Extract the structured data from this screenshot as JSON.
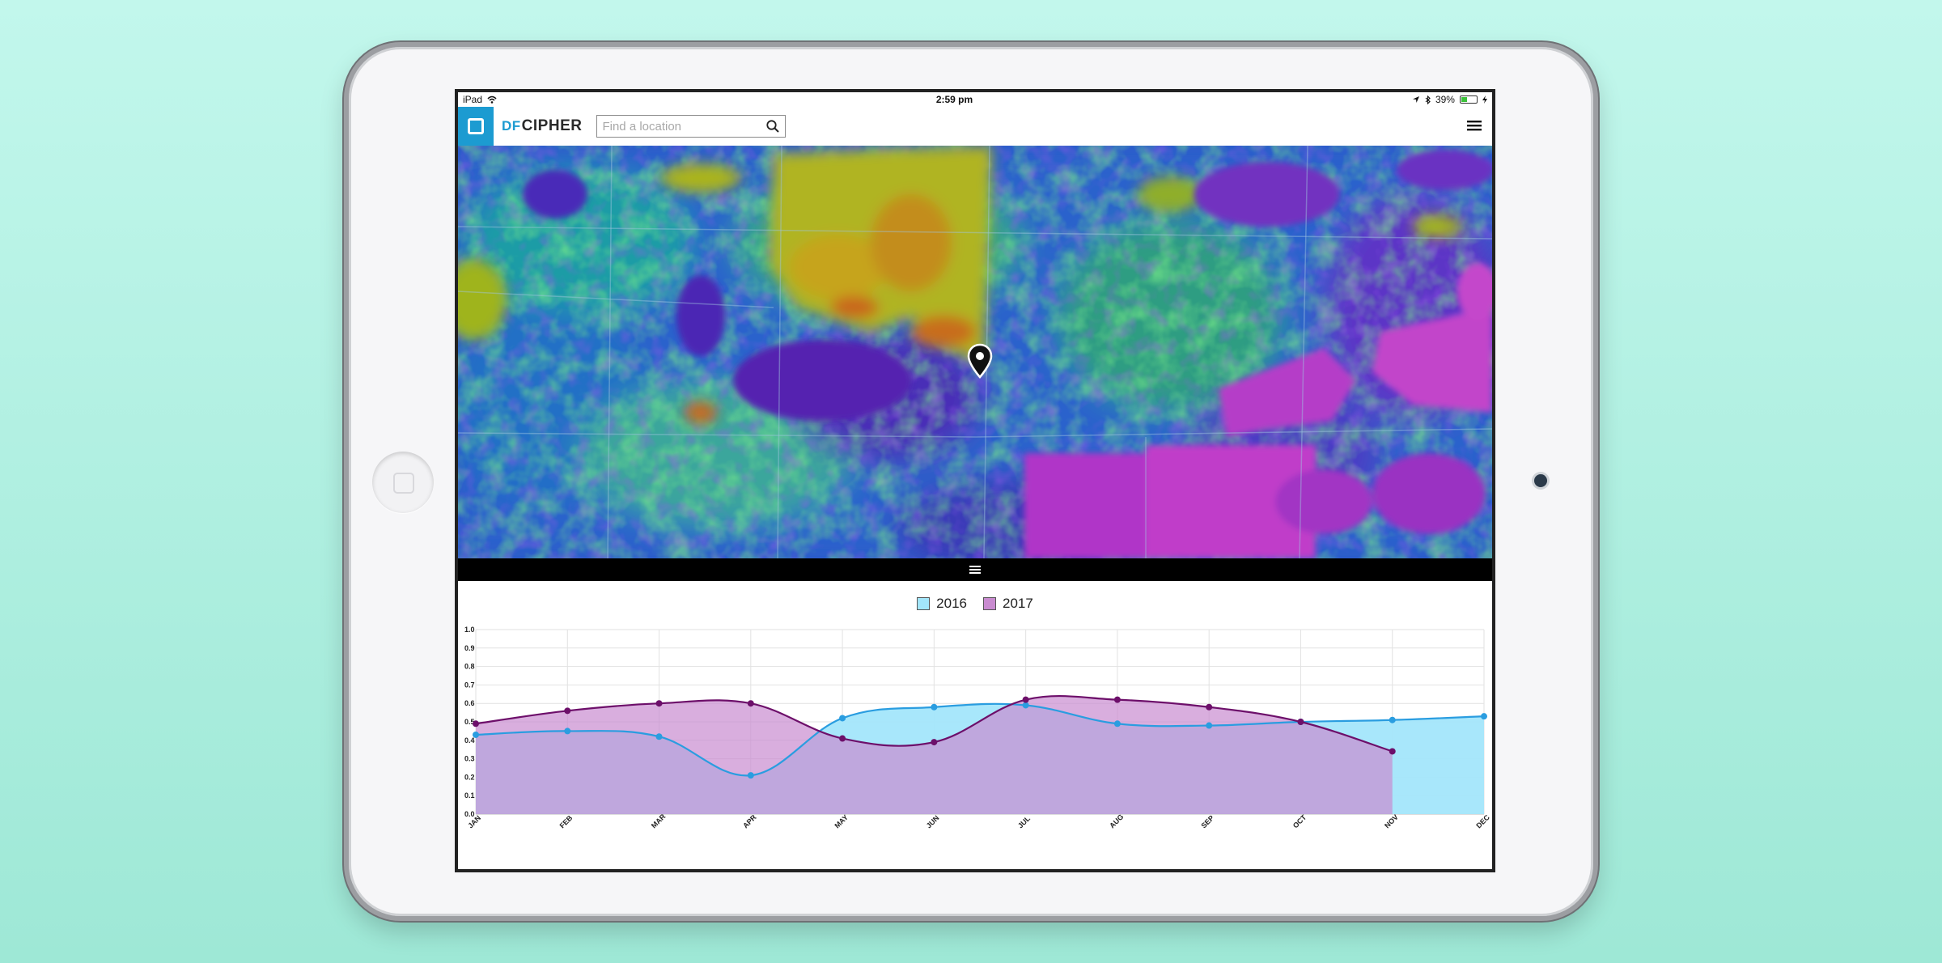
{
  "statusbar": {
    "device": "iPad",
    "time": "2:59 pm",
    "battery": "39%",
    "battery_level": 0.39
  },
  "navbar": {
    "logo_prefix": "DF",
    "logo_text": "CIPHER",
    "search_placeholder": "Find a location"
  },
  "icons": {
    "app": "app-square-icon",
    "search": "search-icon",
    "menu": "hamburger-menu-icon",
    "pin": "map-pin-icon",
    "drawer": "drawer-handle-icon",
    "wifi": "wifi-icon",
    "location": "location-arrow-icon",
    "bluetooth": "bluetooth-icon",
    "battery": "battery-icon",
    "charging": "charging-bolt-icon"
  },
  "colors": {
    "accent": "#1c9bd1",
    "series_2016_line": "#2a9de0",
    "series_2016_fill": "#a3e6fb",
    "series_2017_line": "#6d0f6a",
    "series_2017_fill": "#c98bd0"
  },
  "chart_data": {
    "type": "area",
    "categories": [
      "JAN",
      "FEB",
      "MAR",
      "APR",
      "MAY",
      "JUN",
      "JUL",
      "AUG",
      "SEP",
      "OCT",
      "NOV",
      "DEC"
    ],
    "series": [
      {
        "name": "2016",
        "values": [
          0.43,
          0.45,
          0.42,
          0.21,
          0.52,
          0.58,
          0.59,
          0.49,
          0.48,
          0.5,
          0.51,
          0.53
        ]
      },
      {
        "name": "2017",
        "values": [
          0.49,
          0.56,
          0.6,
          0.6,
          0.41,
          0.39,
          0.62,
          0.62,
          0.58,
          0.5,
          0.34
        ]
      }
    ],
    "yticks": [
      "0.0",
      "0.1",
      "0.2",
      "0.3",
      "0.4",
      "0.5",
      "0.6",
      "0.7",
      "0.8",
      "0.9",
      "1.0"
    ],
    "ylim": [
      0,
      1
    ],
    "grid": true,
    "legend": "top-center",
    "title": "",
    "xlabel": "",
    "ylabel": ""
  }
}
